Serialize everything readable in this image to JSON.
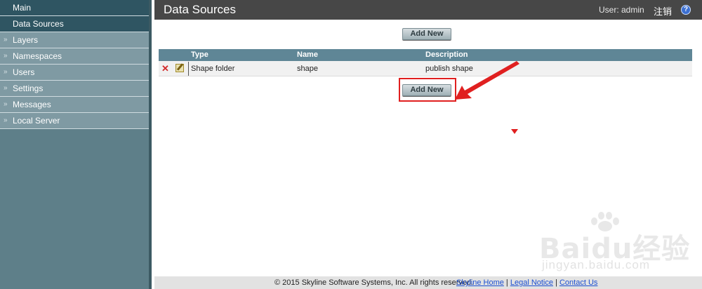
{
  "sidebar": {
    "items": [
      {
        "label": "Main"
      },
      {
        "label": "Data Sources"
      },
      {
        "label": "Layers"
      },
      {
        "label": "Namespaces"
      },
      {
        "label": "Users"
      },
      {
        "label": "Settings"
      },
      {
        "label": "Messages"
      },
      {
        "label": "Local Server"
      }
    ],
    "chevron": "»"
  },
  "header": {
    "title": "Data Sources",
    "user_label": "User: admin",
    "logout_label": "注销",
    "help_glyph": "?"
  },
  "toolbar": {
    "add_new_label": "Add New"
  },
  "table": {
    "columns": [
      "Type",
      "Name",
      "Description"
    ],
    "rows": [
      {
        "type": "Shape folder",
        "name": "shape",
        "description": "publish shape"
      }
    ],
    "delete_glyph": "✕"
  },
  "footer": {
    "copyright": "© 2015 Skyline Software Systems, Inc. All rights reserved.",
    "links": [
      "Skyline Home",
      "Legal Notice",
      "Contact Us"
    ],
    "separator": "|"
  },
  "watermark": {
    "brand": "Baidu经验",
    "url": "jingyan.baidu.com"
  },
  "colors": {
    "accent_annotation": "#e02020",
    "header_bg": "#474747",
    "sidebar_bg": "#5e7f89",
    "table_header_bg": "#5f8696",
    "link": "#1b4fd1"
  }
}
